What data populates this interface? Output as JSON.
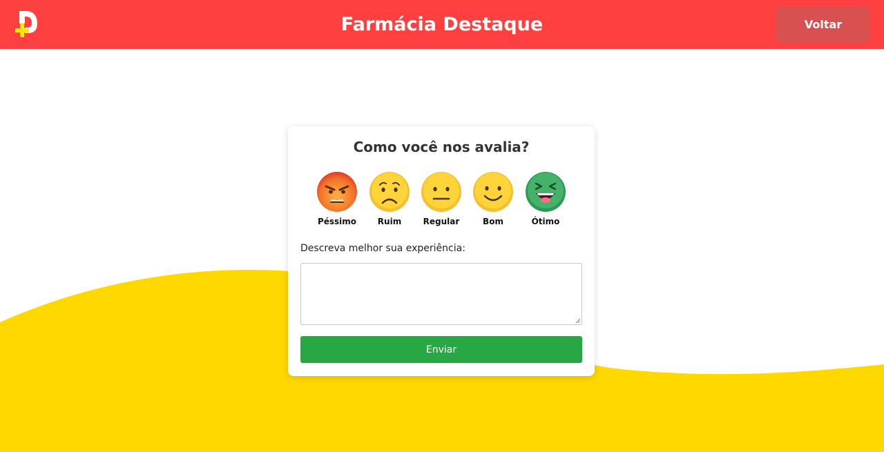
{
  "header": {
    "title": "Farmácia Destaque",
    "back_label": "Voltar",
    "logo_icon": "pharmacy-d-cross-logo",
    "background_color": "#ff4040"
  },
  "rating": {
    "question": "Como você nos avalia?",
    "options": [
      {
        "label": "Péssimo",
        "icon": "angry-face-icon"
      },
      {
        "label": "Ruim",
        "icon": "sad-face-icon"
      },
      {
        "label": "Regular",
        "icon": "neutral-face-icon"
      },
      {
        "label": "Bom",
        "icon": "smile-face-icon"
      },
      {
        "label": "Ótimo",
        "icon": "laughing-face-icon"
      }
    ]
  },
  "feedback": {
    "label": "Descreva melhor sua experiência:",
    "value": "",
    "placeholder": ""
  },
  "submit": {
    "label": "Enviar",
    "color": "#28a745"
  },
  "theme": {
    "wave_color": "#ffd800"
  }
}
